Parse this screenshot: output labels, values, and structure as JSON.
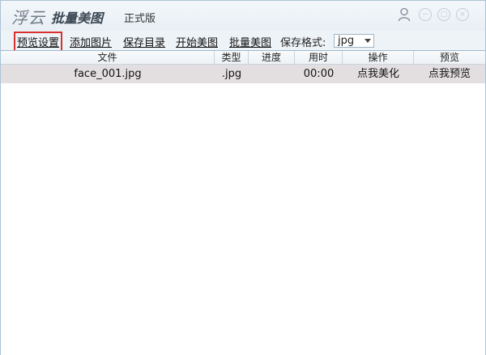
{
  "app": {
    "brand": "浮云",
    "name": "批量美图",
    "edition": "正式版"
  },
  "titlebar_buttons": {
    "user": "user-icon",
    "minimize": "−",
    "maximize": "▢",
    "close": "×"
  },
  "toolbar": {
    "preview_settings": "预览设置",
    "add_images": "添加图片",
    "save_dir": "保存目录",
    "start_beautify": "开始美图",
    "batch_beautify": "批量美图",
    "format_label": "保存格式:",
    "format_value": "jpg"
  },
  "table": {
    "headers": [
      "文件",
      "类型",
      "进度",
      "用时",
      "操作",
      "预览"
    ],
    "rows": [
      {
        "file": "face_001.jpg",
        "type": ".jpg",
        "progress": "",
        "time": "00:00",
        "action": "点我美化",
        "preview": "点我预览"
      }
    ]
  },
  "colors": {
    "accent_border": "#d9302f",
    "selected_row": "#e3dfe0",
    "window_border": "#a9c3d6"
  }
}
